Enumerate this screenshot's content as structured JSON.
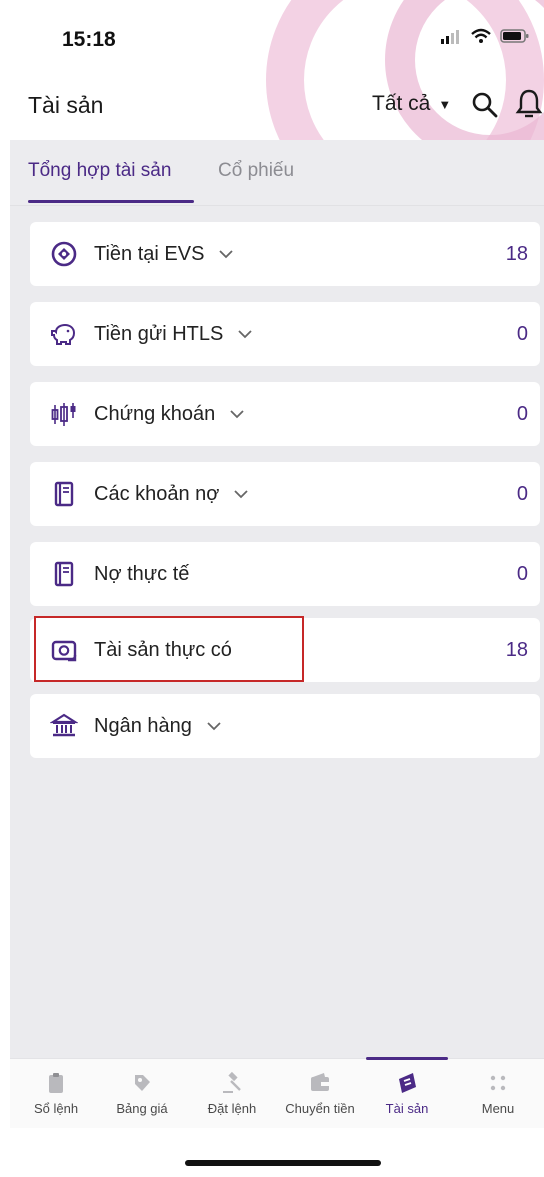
{
  "status_bar": {
    "time": "15:18"
  },
  "header": {
    "title": "Tài sản",
    "filter_label": "Tất cả"
  },
  "tabs": [
    {
      "label": "Tổng hợp tài sản",
      "active": true
    },
    {
      "label": "Cổ phiếu",
      "active": false
    }
  ],
  "assets": [
    {
      "label": "Tiền tại EVS",
      "value": "18",
      "expandable": true,
      "icon": "target-icon"
    },
    {
      "label": "Tiền gửi HTLS",
      "value": "0",
      "expandable": true,
      "icon": "piggy-bank-icon"
    },
    {
      "label": "Chứng khoán",
      "value": "0",
      "expandable": true,
      "icon": "candlestick-icon"
    },
    {
      "label": "Các khoản nợ",
      "value": "0",
      "expandable": true,
      "icon": "notebook-icon"
    },
    {
      "label": "Nợ thực tế",
      "value": "0",
      "expandable": false,
      "icon": "notebook-icon"
    },
    {
      "label": "Tài sản thực có",
      "value": "18",
      "expandable": false,
      "icon": "camera-icon"
    },
    {
      "label": "Ngân hàng",
      "value": "",
      "expandable": true,
      "icon": "bank-icon"
    }
  ],
  "bottom_nav": [
    {
      "label": "Sổ lệnh",
      "icon": "clipboard-icon",
      "active": false
    },
    {
      "label": "Bảng giá",
      "icon": "tag-icon",
      "active": false
    },
    {
      "label": "Đặt lệnh",
      "icon": "gavel-icon",
      "active": false
    },
    {
      "label": "Chuyển tiền",
      "icon": "wallet-icon",
      "active": false
    },
    {
      "label": "Tài sản",
      "icon": "assets-icon",
      "active": true
    },
    {
      "label": "Menu",
      "icon": "grid-icon",
      "active": false
    }
  ],
  "colors": {
    "accent": "#4b2a86",
    "highlight_border": "#c62828",
    "background": "#ebebee"
  }
}
